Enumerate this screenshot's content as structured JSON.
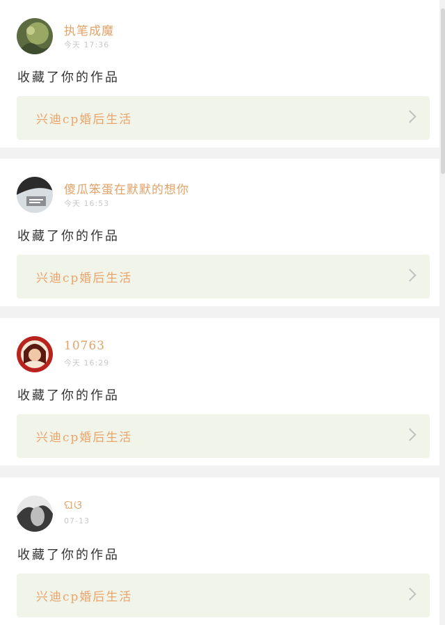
{
  "notifications": [
    {
      "username": "执笔成魔",
      "time": "今天 17:36",
      "action": "收藏了你的作品",
      "work_title": "兴迪cp婚后生活",
      "avatar_colors": [
        "#6b7a4a",
        "#a9b86c",
        "#3f4d2f"
      ]
    },
    {
      "username": "傻瓜笨蛋在默默的想你",
      "time": "今天 16:53",
      "action": "收藏了你的作品",
      "work_title": "兴迪cp婚后生活",
      "avatar_colors": [
        "#2b2b2b",
        "#8a8e93",
        "#d8dde2"
      ]
    },
    {
      "username": "10763",
      "time": "今天 16:29",
      "action": "收藏了你的作品",
      "work_title": "兴迪cp婚后生活",
      "avatar_colors": [
        "#b8231d",
        "#f0c8a8",
        "#5a1a12"
      ]
    },
    {
      "username": "ଘଓ",
      "time": "07-13",
      "action": "收藏了你的作品",
      "work_title": "兴迪cp婚后生活",
      "avatar_colors": [
        "#3a3a3a",
        "#bdbdbd",
        "#e8e8e8"
      ]
    }
  ],
  "colors": {
    "background": "#f2f2f2",
    "card": "#ffffff",
    "username": "#e2a268",
    "work_bg": "#f1f4e9",
    "work_text": "#eaa46b"
  }
}
